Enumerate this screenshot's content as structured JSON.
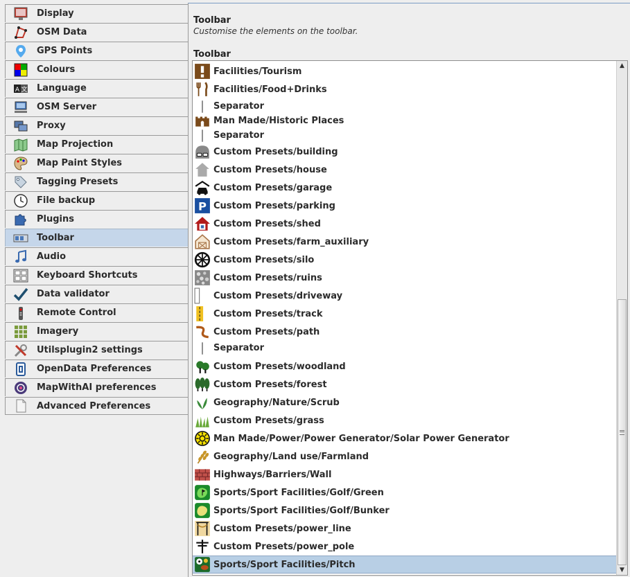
{
  "nav": {
    "items": [
      {
        "label": "Display",
        "icon": "display-icon"
      },
      {
        "label": "OSM Data",
        "icon": "osm-data-icon"
      },
      {
        "label": "GPS Points",
        "icon": "gps-pin-icon"
      },
      {
        "label": "Colours",
        "icon": "colours-icon"
      },
      {
        "label": "Language",
        "icon": "language-icon"
      },
      {
        "label": "OSM Server",
        "icon": "server-icon"
      },
      {
        "label": "Proxy",
        "icon": "proxy-icon"
      },
      {
        "label": "Map Projection",
        "icon": "map-projection-icon"
      },
      {
        "label": "Map Paint Styles",
        "icon": "palette-icon"
      },
      {
        "label": "Tagging Presets",
        "icon": "tag-icon"
      },
      {
        "label": "File backup",
        "icon": "clock-icon"
      },
      {
        "label": "Plugins",
        "icon": "puzzle-icon"
      },
      {
        "label": "Toolbar",
        "icon": "toolbar-icon",
        "active": true
      },
      {
        "label": "Audio",
        "icon": "music-note-icon"
      },
      {
        "label": "Keyboard Shortcuts",
        "icon": "keyboard-icon"
      },
      {
        "label": "Data validator",
        "icon": "checkmark-icon"
      },
      {
        "label": "Remote Control",
        "icon": "remote-icon"
      },
      {
        "label": "Imagery",
        "icon": "imagery-grid-icon"
      },
      {
        "label": "Utilsplugin2 settings",
        "icon": "tools-icon"
      },
      {
        "label": "OpenData Preferences",
        "icon": "opendata-icon"
      },
      {
        "label": "MapWithAI preferences",
        "icon": "mapwithai-icon"
      },
      {
        "label": "Advanced Preferences",
        "icon": "document-icon"
      }
    ]
  },
  "panel": {
    "title": "Toolbar",
    "subtitle": "Customise the elements on the toolbar.",
    "list_heading": "Toolbar"
  },
  "toolbar_list": [
    {
      "label": "Facilities/Tourism",
      "icon": "exclamation-icon"
    },
    {
      "label": "Facilities/Food+Drinks",
      "icon": "fork-knife-icon"
    },
    {
      "label": "Separator",
      "icon": "separator-icon"
    },
    {
      "label": "Man Made/Historic Places",
      "icon": "castle-icon"
    },
    {
      "label": "Separator",
      "icon": "separator-icon"
    },
    {
      "label": "Custom Presets/building",
      "icon": "building-icon"
    },
    {
      "label": "Custom Presets/house",
      "icon": "house-icon"
    },
    {
      "label": "Custom Presets/garage",
      "icon": "garage-icon"
    },
    {
      "label": "Custom Presets/parking",
      "icon": "parking-icon"
    },
    {
      "label": "Custom Presets/shed",
      "icon": "shed-icon"
    },
    {
      "label": "Custom Presets/farm_auxiliary",
      "icon": "barn-icon"
    },
    {
      "label": "Custom Presets/silo",
      "icon": "silo-icon"
    },
    {
      "label": "Custom Presets/ruins",
      "icon": "ruins-icon"
    },
    {
      "label": "Custom Presets/driveway",
      "icon": "driveway-icon"
    },
    {
      "label": "Custom Presets/track",
      "icon": "track-icon"
    },
    {
      "label": "Custom Presets/path",
      "icon": "path-icon"
    },
    {
      "label": "Separator",
      "icon": "separator-icon"
    },
    {
      "label": "Custom Presets/woodland",
      "icon": "woodland-icon"
    },
    {
      "label": "Custom Presets/forest",
      "icon": "forest-icon"
    },
    {
      "label": "Geography/Nature/Scrub",
      "icon": "scrub-icon"
    },
    {
      "label": "Custom Presets/grass",
      "icon": "grass-icon"
    },
    {
      "label": "Man Made/Power/Power Generator/Solar Power Generator",
      "icon": "sun-icon"
    },
    {
      "label": "Geography/Land use/Farmland",
      "icon": "wheat-icon"
    },
    {
      "label": "Highways/Barriers/Wall",
      "icon": "brick-wall-icon"
    },
    {
      "label": "Sports/Sport Facilities/Golf/Green",
      "icon": "golf-green-icon"
    },
    {
      "label": "Sports/Sport Facilities/Golf/Bunker",
      "icon": "golf-bunker-icon"
    },
    {
      "label": "Custom Presets/power_line",
      "icon": "power-line-icon"
    },
    {
      "label": "Custom Presets/power_pole",
      "icon": "power-pole-icon"
    },
    {
      "label": "Sports/Sport Facilities/Pitch",
      "icon": "pitch-icon",
      "selected": true
    }
  ]
}
